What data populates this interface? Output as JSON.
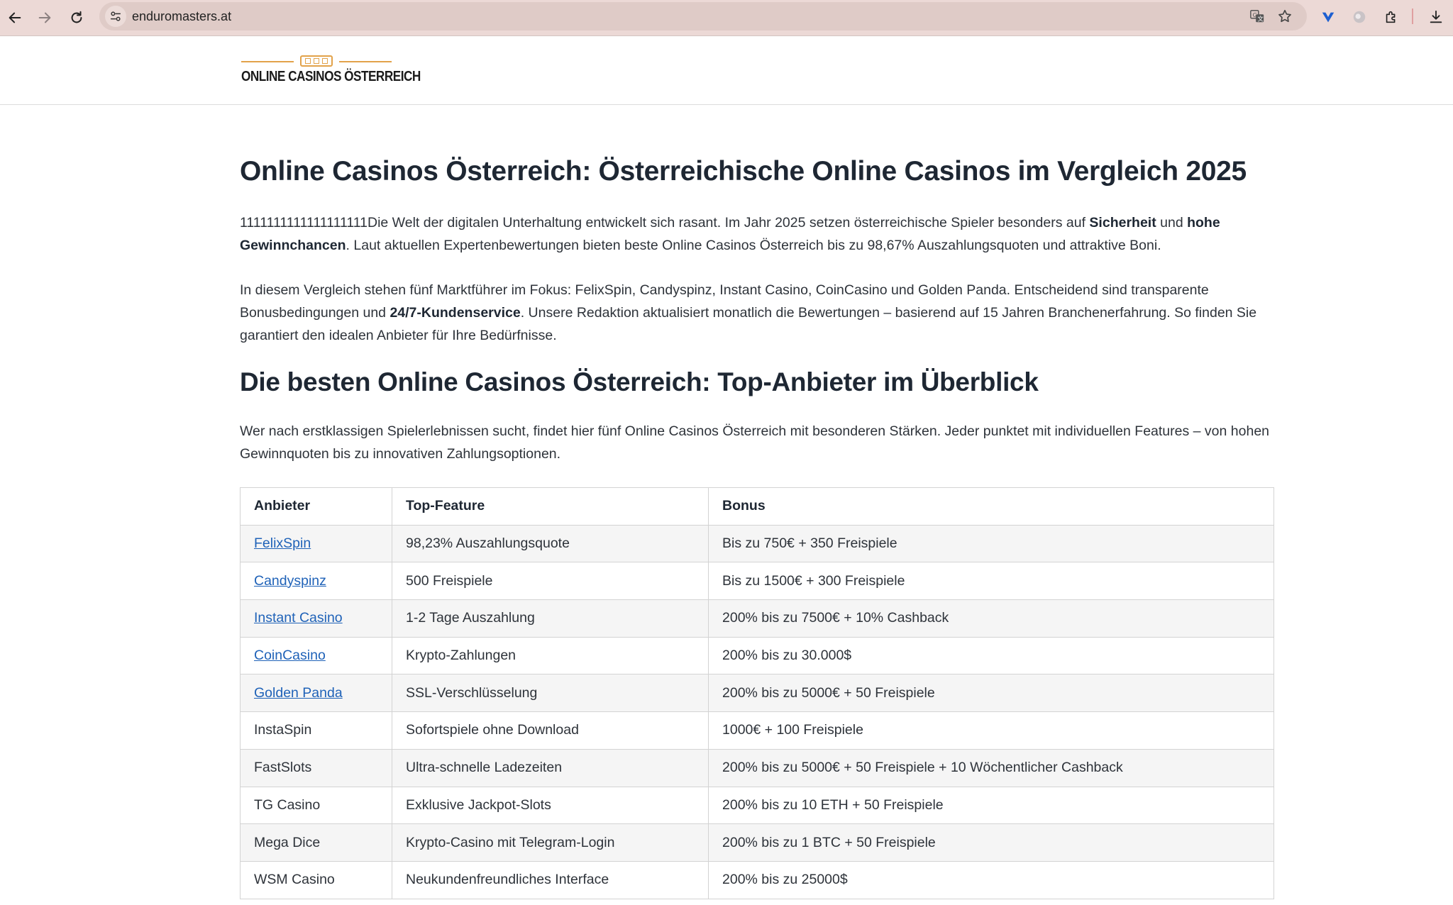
{
  "browser": {
    "url": "enduromasters.at"
  },
  "site": {
    "logo_text": "ONLINE CASINOS ÖSTERREICH"
  },
  "page": {
    "h1": "Online Casinos Österreich: Österreichische Online Casinos im Vergleich 2025",
    "intro": {
      "prefix": "1111111111111111111Die Welt der digitalen Unterhaltung entwickelt sich rasant. Im Jahr 2025 setzen österreichische Spieler besonders auf ",
      "bold1": "Sicherheit",
      "mid": " und ",
      "bold2": "hohe Gewinnchancen",
      "suffix": ". Laut aktuellen Expertenbewertungen bieten beste Online Casinos Österreich bis zu 98,67% Auszahlungsquoten und attraktive Boni."
    },
    "para2": {
      "prefix": "In diesem Vergleich stehen fünf Marktführer im Fokus: FelixSpin, Candyspinz, Instant Casino, CoinCasino und Golden Panda. Entscheidend sind transparente Bonusbedingungen und ",
      "bold": "24/7-Kundenservice",
      "suffix": ". Unsere Redaktion aktualisiert monatlich die Bewertungen – basierend auf 15 Jahren Branchenerfahrung. So finden Sie garantiert den idealen Anbieter für Ihre Bedürfnisse."
    },
    "h2": "Die besten Online Casinos Österreich: Top-Anbieter im Überblick",
    "para3": "Wer nach erstklassigen Spielerlebnissen sucht, findet hier fünf Online Casinos Österreich mit besonderen Stärken. Jeder punktet mit individuellen Features – von hohen Gewinnquoten bis zu innovativen Zahlungsoptionen."
  },
  "table": {
    "headers": [
      "Anbieter",
      "Top-Feature",
      "Bonus"
    ],
    "rows": [
      {
        "provider": "FelixSpin",
        "link": true,
        "feature": "98,23% Auszahlungsquote",
        "bonus": "Bis zu 750€ + 350 Freispiele"
      },
      {
        "provider": "Candyspinz",
        "link": true,
        "feature": "500 Freispiele",
        "bonus": "Bis zu 1500€ + 300 Freispiele"
      },
      {
        "provider": "Instant Casino",
        "link": true,
        "feature": "1-2 Tage Auszahlung",
        "bonus": "200% bis zu 7500€ + 10% Cashback"
      },
      {
        "provider": "CoinCasino",
        "link": true,
        "feature": "Krypto-Zahlungen",
        "bonus": "200% bis zu 30.000$"
      },
      {
        "provider": "Golden Panda",
        "link": true,
        "feature": "SSL-Verschlüsselung",
        "bonus": "200% bis zu 5000€ + 50 Freispiele"
      },
      {
        "provider": "InstaSpin",
        "link": false,
        "feature": "Sofortspiele ohne Download",
        "bonus": "1000€ + 100 Freispiele"
      },
      {
        "provider": "FastSlots",
        "link": false,
        "feature": "Ultra-schnelle Ladezeiten",
        "bonus": "200% bis zu 5000€ + 50 Freispiele + 10 Wöchentlicher Cashback"
      },
      {
        "provider": "TG Casino",
        "link": false,
        "feature": "Exklusive Jackpot-Slots",
        "bonus": "200% bis zu 10 ETH + 50 Freispiele"
      },
      {
        "provider": "Mega Dice",
        "link": false,
        "feature": "Krypto-Casino mit Telegram-Login",
        "bonus": "200% bis zu 1 BTC + 50 Freispiele"
      },
      {
        "provider": "WSM Casino",
        "link": false,
        "feature": "Neukundenfreundliches Interface",
        "bonus": "200% bis zu 25000$"
      }
    ]
  }
}
